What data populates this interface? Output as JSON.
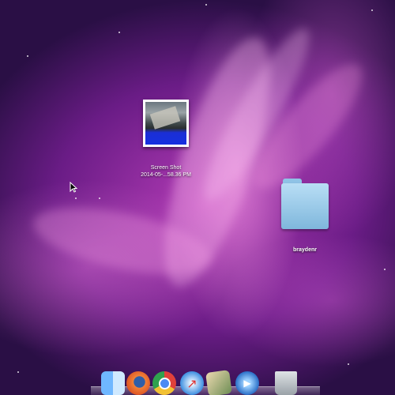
{
  "desktop": {
    "icons": [
      {
        "label_line1": "Screen Shot",
        "label_line2": "2014-05-...58.36 PM",
        "icon": "image-thumbnail-icon"
      },
      {
        "label": "braydenr",
        "icon": "folder-icon"
      }
    ]
  },
  "dock": {
    "items": [
      {
        "name": "Finder",
        "icon": "finder-icon"
      },
      {
        "name": "Firefox",
        "icon": "firefox-icon"
      },
      {
        "name": "Google Chrome",
        "icon": "chrome-icon"
      },
      {
        "name": "Safari",
        "icon": "safari-icon"
      },
      {
        "name": "Preview",
        "icon": "preview-icon"
      },
      {
        "name": "QuickTime Player",
        "icon": "quicktime-icon"
      },
      {
        "name": "Trash",
        "icon": "trash-icon"
      }
    ]
  },
  "colors": {
    "wallpaper_primary": "#b23bb5",
    "wallpaper_dark": "#2a0f45",
    "folder": "#8fc3e6"
  }
}
